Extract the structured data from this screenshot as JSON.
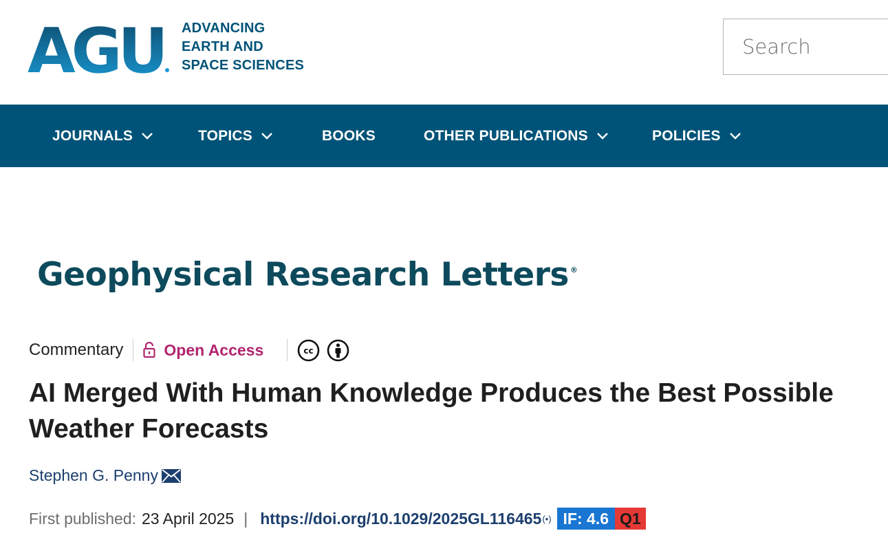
{
  "header": {
    "logo_mark": "AGU",
    "logo_tagline": [
      "ADVANCING",
      "EARTH AND",
      "SPACE SCIENCES"
    ],
    "search_placeholder": "Search"
  },
  "nav": {
    "items": [
      {
        "label": "JOURNALS",
        "has_dropdown": true
      },
      {
        "label": "TOPICS",
        "has_dropdown": true
      },
      {
        "label": "BOOKS",
        "has_dropdown": false
      },
      {
        "label": "OTHER PUBLICATIONS",
        "has_dropdown": true
      },
      {
        "label": "POLICIES",
        "has_dropdown": true
      }
    ]
  },
  "journal": {
    "title": "Geophysical Research Letters",
    "mark": "®"
  },
  "article": {
    "type": "Commentary",
    "access": "Open Access",
    "license_icons": [
      "cc-icon",
      "by-icon"
    ],
    "title": "AI Merged With Human Knowledge Produces the Best Possible Weather Forecasts",
    "author": "Stephen G. Penny",
    "published_label": "First published:",
    "published_date": "23 April 2025",
    "separator": "|",
    "doi": "https://doi.org/10.1029/2025GL116465",
    "doi_icon": "(•)",
    "impact_factor": "IF: 4.6",
    "quartile": "Q1"
  },
  "colors": {
    "brand": "#005378",
    "logo_light": "#1a9bd7",
    "open_access": "#b2256f",
    "link": "#1c3f6e",
    "if_badge": "#1976d2",
    "q_badge": "#e53935"
  }
}
